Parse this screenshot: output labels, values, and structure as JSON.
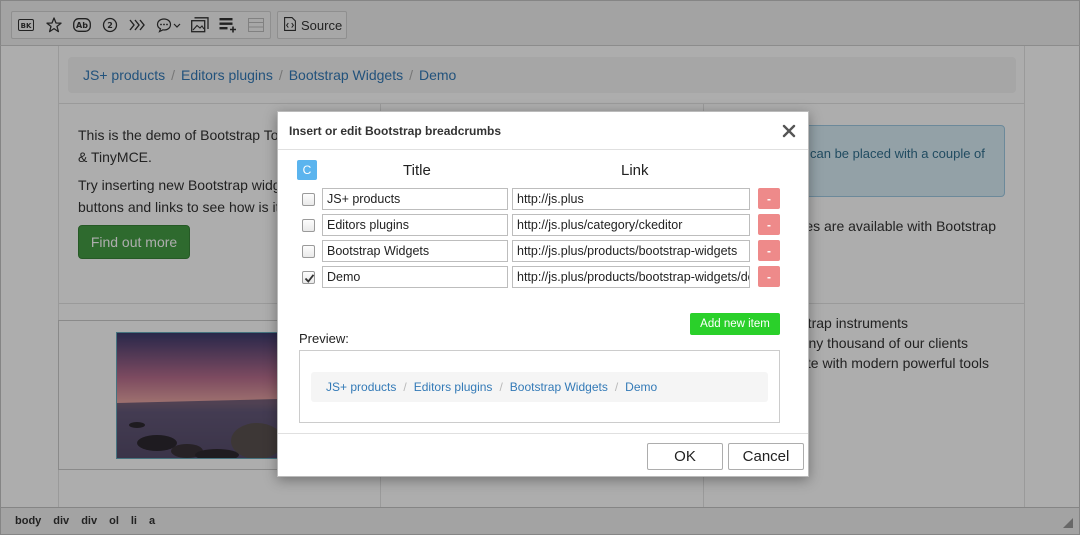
{
  "toolbar": {
    "buttons": [
      {
        "name": "bootstrap-widgets-icon"
      },
      {
        "name": "star-icon"
      },
      {
        "name": "ab-badge-icon"
      },
      {
        "name": "number-circle-icon"
      },
      {
        "name": "breadcrumbs-icon"
      },
      {
        "name": "tooltip-dropdown-icon"
      },
      {
        "name": "image-gallery-icon"
      },
      {
        "name": "list-add-icon"
      },
      {
        "name": "table-disabled-icon"
      }
    ],
    "source_label": "Source"
  },
  "background": {
    "breadcrumb": [
      "JS+ products",
      "Editors plugins",
      "Bootstrap Widgets",
      "Demo"
    ],
    "left_text_1": [
      "This is the demo of Bootstrap Tools",
      "& TinyMCE."
    ],
    "left_text_2": [
      "Try inserting new Bootstrap widget",
      "buttons and links to see how is it si"
    ],
    "find_out_more": "Find out more",
    "alert_text": [
      "can be placed with a couple of"
    ],
    "right_text_1": [
      "tures are available with Bootstrap"
    ],
    "right_text_2": [
      "otstrap instruments",
      " many thousand of our clients",
      "bsite with modern powerful tools",
      "ow."
    ]
  },
  "modal": {
    "title": "Insert or edit Bootstrap breadcrumbs",
    "c_badge": "C",
    "col_title": "Title",
    "col_link": "Link",
    "rows": [
      {
        "title": "JS+ products",
        "link": "http://js.plus",
        "checked": false
      },
      {
        "title": "Editors plugins",
        "link": "http://js.plus/category/ckeditor",
        "checked": false
      },
      {
        "title": "Bootstrap Widgets",
        "link": "http://js.plus/products/bootstrap-widgets",
        "checked": false
      },
      {
        "title": "Demo",
        "link": "http://js.plus/products/bootstrap-widgets/de",
        "checked": true
      }
    ],
    "remove_label": "-",
    "add_label": "Add new item",
    "preview_label": "Preview:",
    "preview_items": [
      "JS+ products",
      "Editors plugins",
      "Bootstrap Widgets",
      "Demo"
    ],
    "ok_label": "OK",
    "cancel_label": "Cancel"
  },
  "statusbar": {
    "path": [
      "body",
      "div",
      "div",
      "ol",
      "li",
      "a"
    ]
  },
  "colors": {
    "link": "#337ab7",
    "add_button": "#2ad02a",
    "remove_button": "#ee8a8a",
    "c_badge": "#5bb4ee"
  }
}
